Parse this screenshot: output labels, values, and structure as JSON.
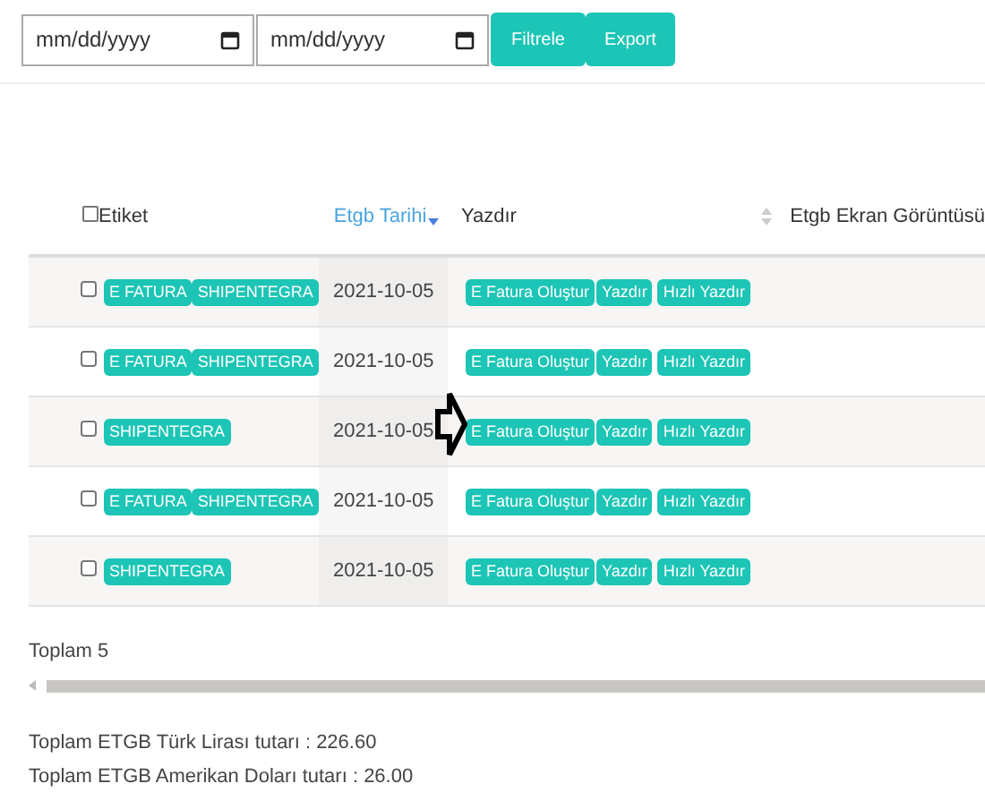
{
  "filter": {
    "date_from": {
      "placeholder": "mm/dd/yyyy"
    },
    "date_to": {
      "placeholder": "mm/dd/yyyy"
    },
    "buttons": [
      "Filtrele",
      "Export"
    ]
  },
  "table": {
    "select_all": {
      "checked": false
    },
    "columns": [
      {
        "label": "Etiket",
        "sorted": false,
        "sortable": false
      },
      {
        "label": "Etgb Tarihi",
        "sorted": true,
        "sortable": false
      },
      {
        "label": "Yazdır",
        "sorted": false,
        "sortable": true
      },
      {
        "label": "Etgb Ekran Görüntüsü",
        "sorted": false,
        "sortable": false
      }
    ],
    "rows": [
      {
        "checked": false,
        "tags": [
          "E FATURA",
          "SHIPENTEGRA"
        ],
        "date": "2021-10-05",
        "actions": [
          "E Fatura Oluştur",
          "Yazdır",
          "Hızlı Yazdır"
        ]
      },
      {
        "checked": false,
        "tags": [
          "E FATURA",
          "SHIPENTEGRA"
        ],
        "date": "2021-10-05",
        "actions": [
          "E Fatura Oluştur",
          "Yazdır",
          "Hızlı Yazdır"
        ]
      },
      {
        "checked": false,
        "tags": [
          "SHIPENTEGRA"
        ],
        "date": "2021-10-05",
        "actions": [
          "E Fatura Oluştur",
          "Yazdır",
          "Hızlı Yazdır"
        ]
      },
      {
        "checked": false,
        "tags": [
          "E FATURA",
          "SHIPENTEGRA"
        ],
        "date": "2021-10-05",
        "actions": [
          "E Fatura Oluştur",
          "Yazdır",
          "Hızlı Yazdır"
        ]
      },
      {
        "checked": false,
        "tags": [
          "SHIPENTEGRA"
        ],
        "date": "2021-10-05",
        "actions": [
          "E Fatura Oluştur",
          "Yazdır",
          "Hızlı Yazdır"
        ]
      }
    ]
  },
  "total": "Toplam 5",
  "summary": [
    "Toplam ETGB Türk Lirası tutarı : 226.60",
    "Toplam ETGB Amerikan Doları tutarı : 26.00"
  ]
}
